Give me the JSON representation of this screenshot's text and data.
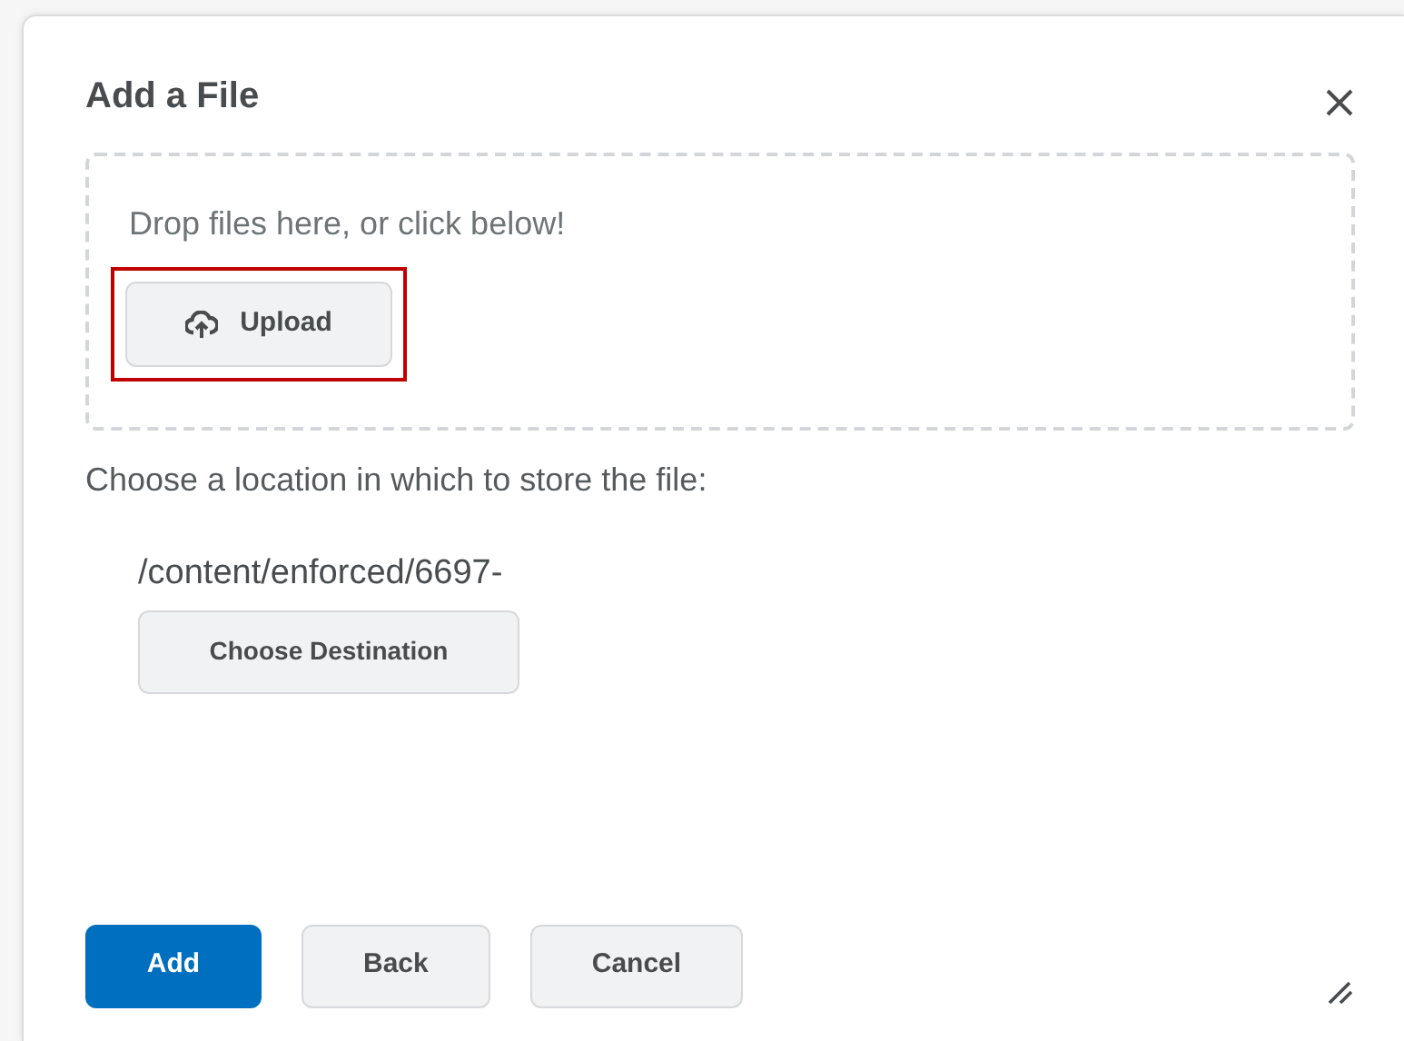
{
  "dialog": {
    "title": "Add a File",
    "drop_zone": {
      "prompt": "Drop files here, or click below!",
      "upload_button": {
        "label": "Upload",
        "highlighted": true
      }
    },
    "location_prompt": "Choose a location in which to store the file:",
    "location_path": "/content/enforced/6697-",
    "choose_button": "Choose Destination",
    "buttons": [
      {
        "label": "Add",
        "kind": "primary"
      },
      {
        "label": "Back",
        "kind": "secondary"
      },
      {
        "label": "Cancel",
        "kind": "secondary"
      }
    ]
  }
}
